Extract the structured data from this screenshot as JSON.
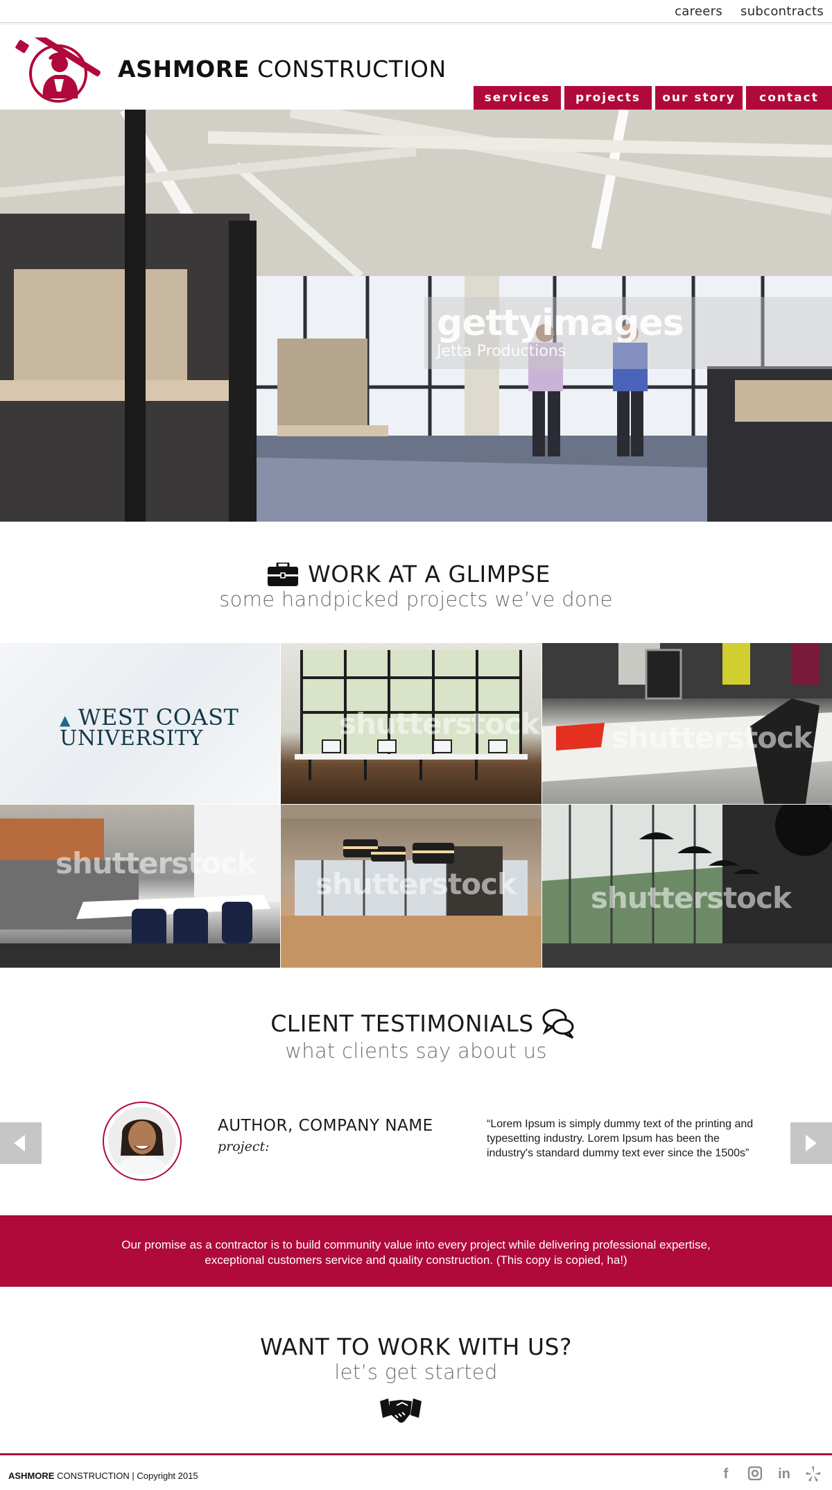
{
  "topbar": {
    "links": [
      "careers",
      "subcontracts"
    ]
  },
  "header": {
    "brand_bold": "ASHMORE",
    "brand_rest": "CONSTRUCTION",
    "nav": [
      "services",
      "projects",
      "our story",
      "contact"
    ]
  },
  "hero": {
    "watermark_title": "gettyimages",
    "watermark_sub": "Jetta Productions"
  },
  "work": {
    "title": "WORK AT A GLIMPSE",
    "subtitle": "some handpicked projects we’ve done",
    "tiles": [
      {
        "logo_line1": "West Coast",
        "logo_line2": "University",
        "watermark": ""
      },
      {
        "watermark": "shutterstock"
      },
      {
        "watermark": "shutterstock"
      },
      {
        "watermark": "shutterstock"
      },
      {
        "watermark": "shutterstock"
      },
      {
        "watermark": "shutterstock"
      }
    ]
  },
  "testimonials": {
    "title": "CLIENT TESTIMONIALS",
    "subtitle": "what clients say about us",
    "author": "AUTHOR, COMPANY NAME",
    "project_label": "project:",
    "quote": "“Lorem Ipsum is simply dummy text of the printing and typesetting industry. Lorem Ipsum has been the industry's standard dummy text ever since the 1500s”"
  },
  "promise": {
    "text": "Our promise as a contractor is to build community value into every project while delivering professional expertise, exceptional customers service and quality construction. (This copy is copied, ha!)"
  },
  "cta": {
    "title": "WANT TO WORK WITH US?",
    "subtitle": "let’s get started"
  },
  "footer": {
    "brand_bold": "ASHMORE",
    "brand_rest": "CONSTRUCTION | Copyright 2015",
    "social_icons": [
      "facebook-icon",
      "instagram-icon",
      "linkedin-icon",
      "yelp-icon"
    ]
  },
  "colors": {
    "brand": "#b0093b",
    "arrow_gray": "#c6c6c6"
  }
}
